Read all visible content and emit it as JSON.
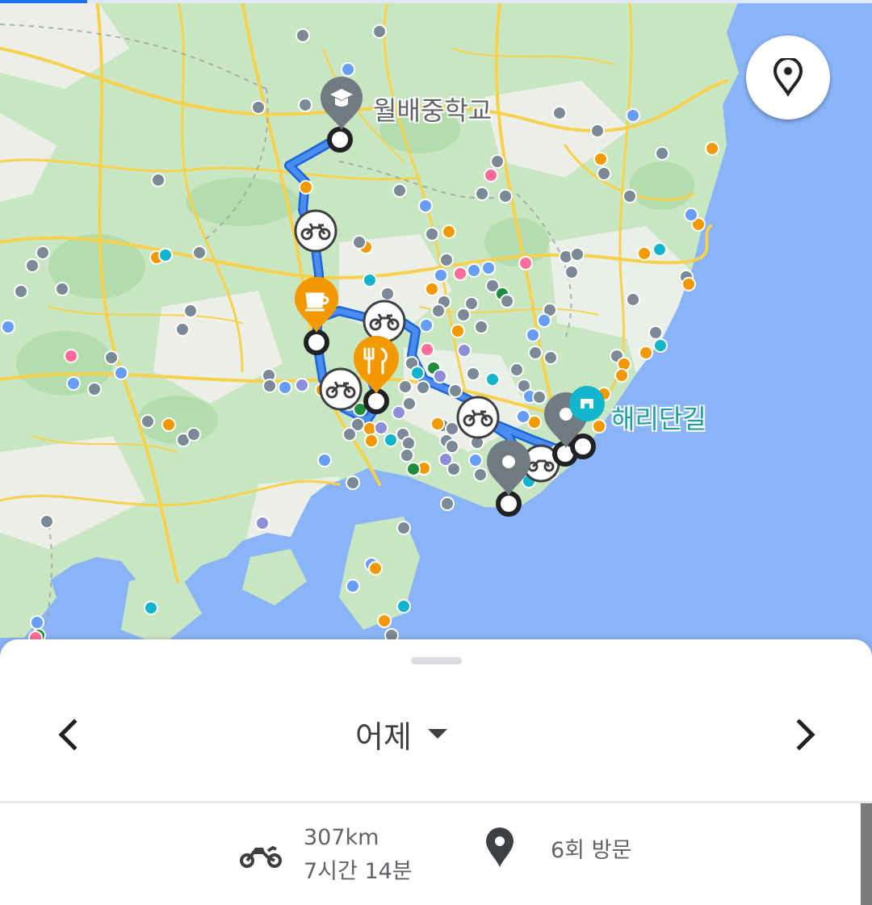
{
  "map": {
    "labels": {
      "school": "월배중학교",
      "street": "해리단길"
    },
    "colors": {
      "land": "#c9e6c3",
      "urban": "#eef0ec",
      "sea": "#8ab4f8",
      "road": "#f7d14c",
      "route": "#4a8cf0",
      "pin_gray": "#6f7a82",
      "pin_orange": "#f29900",
      "pin_teal": "#12b5cb"
    },
    "markers": [
      {
        "type": "school",
        "icon": "graduation-cap-icon"
      },
      {
        "type": "cafe",
        "icon": "coffee-cup-icon"
      },
      {
        "type": "restaurant",
        "icon": "fork-knife-icon"
      },
      {
        "type": "place",
        "icon": "location-pin-icon"
      },
      {
        "type": "place",
        "icon": "location-pin-icon"
      },
      {
        "type": "street",
        "icon": "shop-icon"
      }
    ]
  },
  "locate_button": {
    "icon": "location-pin-icon"
  },
  "sheet": {
    "date_label": "어제",
    "prev_icon": "chevron-left-icon",
    "next_icon": "chevron-right-icon",
    "dropdown_icon": "caret-down-icon"
  },
  "summary": {
    "distance": "307km",
    "duration": "7시간 14분",
    "visits": "6회 방문",
    "transport_icon": "motorcycle-icon",
    "visit_icon": "location-pin-icon"
  }
}
